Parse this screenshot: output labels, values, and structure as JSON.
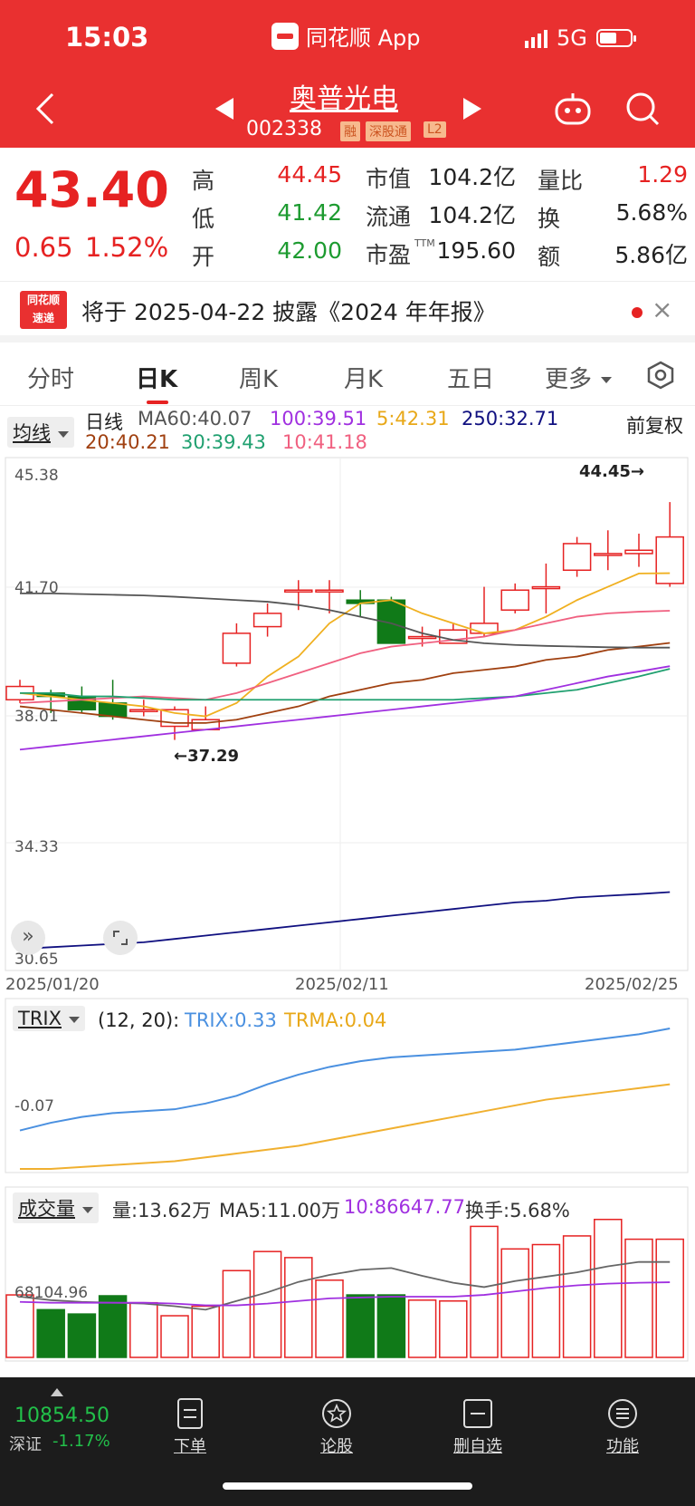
{
  "status_bar": {
    "time": "15:03",
    "app_name": "同花顺 App",
    "network": "5G"
  },
  "stock": {
    "name": "奥普光电",
    "code": "002338",
    "tags": [
      "融",
      "深股通",
      "L2"
    ],
    "price": "43.40",
    "change": "0.65",
    "change_pct": "1.52%"
  },
  "quote": {
    "high_label": "高",
    "high": "44.45",
    "low_label": "低",
    "low": "41.42",
    "open_label": "开",
    "open": "42.00",
    "mktcap_label": "市值",
    "mktcap": "104.2亿",
    "float_label": "流通",
    "float": "104.2亿",
    "pe_label": "市盈",
    "pe_sup": "TTM",
    "pe": "195.60",
    "vol_ratio_label": "量比",
    "vol_ratio": "1.29",
    "turnover_label": "换",
    "turnover": "5.68%",
    "amount_label": "额",
    "amount": "5.86亿"
  },
  "notice": {
    "logo_line1": "同花顺",
    "logo_line2": "速递",
    "text": "将于 2025-04-22 披露《2024 年年报》",
    "close": "×"
  },
  "tabs": [
    "分时",
    "日K",
    "周K",
    "月K",
    "五日",
    "更多"
  ],
  "kline": {
    "indicator_button": "均线",
    "period": "日线",
    "ma60": "MA60:40.07",
    "ma100": "100:39.51",
    "ma5": "5:42.31",
    "ma250": "250:32.71",
    "ma20": "20:40.21",
    "ma30": "30:39.43",
    "ma10": "10:41.18",
    "adjust": "前复权",
    "y_ticks": [
      "45.38",
      "41.70",
      "38.01",
      "34.33",
      "30.65"
    ],
    "high_marker": "44.45→",
    "low_marker": "←37.29",
    "dates": [
      "2025/01/20",
      "2025/02/11",
      "2025/02/25"
    ]
  },
  "trix": {
    "button": "TRIX",
    "params": "(12, 20):",
    "trix": "TRIX:0.33",
    "trma": "TRMA:0.04",
    "tick": "-0.07"
  },
  "volume": {
    "button": "成交量",
    "vol": "量:13.62万",
    "ma5": "MA5:11.00万",
    "ma10": "10:86647.77",
    "turnover": "换手:5.68%",
    "tick": "68104.96"
  },
  "bottom_nav": {
    "index_value": "10854.50",
    "index_name": "深证",
    "index_change": "-1.17%",
    "items": [
      "下单",
      "论股",
      "删自选",
      "功能"
    ]
  },
  "colors": {
    "up": "#e62222",
    "down": "#107a18",
    "ma5": "#f0b020",
    "ma10": "#f06080",
    "ma20": "#a04010",
    "ma30": "#20a070",
    "ma60": "#555555",
    "ma100": "#a030e0",
    "ma250": "#101080",
    "trix": "#4a90e0",
    "trma": "#f0b030"
  },
  "chart_data": [
    {
      "type": "candlestick",
      "title": "日线",
      "x": [
        "2025/01/20",
        "",
        "",
        "",
        "",
        "",
        "",
        "",
        "",
        "",
        "",
        "",
        "",
        "",
        "",
        "",
        "",
        "",
        "",
        "",
        "",
        "2025/02/25"
      ],
      "open": [
        38.5,
        38.7,
        38.6,
        38.4,
        38.2,
        37.7,
        37.6,
        39.6,
        40.7,
        41.8,
        41.8,
        41.5,
        41.5,
        40.4,
        40.2,
        40.5,
        41.2,
        41.9,
        42.4,
        42.9,
        42.9,
        42.0
      ],
      "close": [
        38.9,
        38.6,
        38.2,
        38.0,
        38.2,
        38.2,
        37.9,
        40.5,
        41.1,
        41.8,
        41.8,
        41.4,
        40.2,
        40.4,
        40.6,
        40.8,
        41.8,
        41.9,
        43.2,
        42.9,
        43.0,
        43.4
      ],
      "high": [
        39.1,
        38.8,
        38.9,
        39.1,
        38.5,
        38.3,
        38.3,
        40.8,
        41.4,
        42.1,
        42.1,
        41.8,
        41.6,
        40.7,
        40.8,
        41.9,
        42.0,
        42.6,
        43.4,
        43.6,
        43.5,
        44.45
      ],
      "low": [
        38.4,
        38.1,
        38.1,
        37.9,
        38.0,
        37.29,
        37.8,
        39.5,
        40.4,
        41.2,
        41.1,
        41.0,
        40.2,
        40.1,
        40.2,
        40.4,
        41.1,
        41.1,
        42.2,
        42.4,
        42.5,
        41.9
      ],
      "series": [
        {
          "name": "MA5",
          "values": [
            38.7,
            38.6,
            38.5,
            38.4,
            38.3,
            38.1,
            38.0,
            38.4,
            39.2,
            39.8,
            40.8,
            41.4,
            41.5,
            41.1,
            40.8,
            40.5,
            40.6,
            41.0,
            41.5,
            41.9,
            42.3,
            42.31
          ]
        },
        {
          "name": "MA10",
          "values": [
            38.4,
            38.45,
            38.5,
            38.55,
            38.6,
            38.55,
            38.5,
            38.7,
            39.0,
            39.3,
            39.6,
            39.9,
            40.1,
            40.2,
            40.3,
            40.4,
            40.6,
            40.8,
            41.0,
            41.1,
            41.15,
            41.18
          ]
        },
        {
          "name": "MA20",
          "values": [
            38.3,
            38.2,
            38.1,
            38.0,
            37.9,
            37.8,
            37.8,
            37.9,
            38.1,
            38.3,
            38.6,
            38.8,
            39.0,
            39.1,
            39.3,
            39.4,
            39.5,
            39.7,
            39.8,
            40.0,
            40.1,
            40.21
          ]
        },
        {
          "name": "MA30",
          "values": [
            38.7,
            38.7,
            38.6,
            38.6,
            38.55,
            38.5,
            38.5,
            38.5,
            38.5,
            38.5,
            38.5,
            38.5,
            38.5,
            38.5,
            38.5,
            38.55,
            38.6,
            38.7,
            38.8,
            39.0,
            39.2,
            39.43
          ]
        },
        {
          "name": "MA60",
          "values": [
            41.7,
            41.7,
            41.68,
            41.66,
            41.64,
            41.6,
            41.55,
            41.5,
            41.45,
            41.35,
            41.2,
            41.0,
            40.8,
            40.5,
            40.3,
            40.2,
            40.15,
            40.12,
            40.1,
            40.08,
            40.07,
            40.07
          ]
        },
        {
          "name": "MA100",
          "values": [
            37.0,
            37.1,
            37.2,
            37.3,
            37.4,
            37.5,
            37.6,
            37.7,
            37.8,
            37.9,
            38.0,
            38.1,
            38.2,
            38.3,
            38.4,
            38.5,
            38.6,
            38.8,
            39.0,
            39.2,
            39.35,
            39.51
          ]
        },
        {
          "name": "MA250",
          "values": [
            31.0,
            31.05,
            31.1,
            31.15,
            31.2,
            31.3,
            31.4,
            31.5,
            31.6,
            31.7,
            31.8,
            31.9,
            32.0,
            32.1,
            32.2,
            32.3,
            32.4,
            32.45,
            32.55,
            32.6,
            32.65,
            32.71
          ]
        }
      ],
      "ylim": [
        30.65,
        45.38
      ]
    },
    {
      "type": "line",
      "title": "TRIX",
      "series": [
        {
          "name": "TRIX",
          "values": [
            -0.2,
            -0.16,
            -0.13,
            -0.11,
            -0.1,
            -0.09,
            -0.06,
            -0.02,
            0.04,
            0.09,
            0.13,
            0.16,
            0.18,
            0.19,
            0.2,
            0.21,
            0.22,
            0.24,
            0.26,
            0.28,
            0.3,
            0.33
          ]
        },
        {
          "name": "TRMA",
          "values": [
            -0.4,
            -0.4,
            -0.39,
            -0.38,
            -0.37,
            -0.36,
            -0.34,
            -0.32,
            -0.3,
            -0.28,
            -0.25,
            -0.22,
            -0.19,
            -0.16,
            -0.13,
            -0.1,
            -0.07,
            -0.04,
            -0.02,
            0.0,
            0.02,
            0.04
          ]
        }
      ]
    },
    {
      "type": "bar",
      "title": "成交量",
      "values": [
        7.2,
        5.5,
        5.0,
        7.1,
        6.3,
        4.8,
        5.9,
        10.0,
        12.2,
        11.5,
        8.9,
        7.2,
        7.2,
        6.6,
        6.5,
        15.1,
        12.5,
        13.0,
        14.0,
        15.9,
        13.62,
        13.62
      ],
      "series": [
        {
          "name": "MA5",
          "values": [
            7.0,
            6.6,
            6.4,
            6.3,
            6.2,
            5.9,
            5.5,
            6.5,
            7.5,
            8.7,
            9.5,
            10.1,
            10.3,
            9.4,
            8.6,
            8.1,
            8.8,
            9.3,
            9.8,
            10.5,
            11.0,
            11.0
          ]
        },
        {
          "name": "10",
          "values": [
            6.4,
            6.3,
            6.3,
            6.3,
            6.3,
            6.2,
            6.0,
            6.0,
            6.2,
            6.5,
            6.8,
            6.9,
            7.0,
            7.0,
            7.0,
            7.2,
            7.6,
            8.0,
            8.3,
            8.5,
            8.6,
            8.66
          ]
        }
      ],
      "ylim": [
        0,
        16.5
      ]
    }
  ]
}
